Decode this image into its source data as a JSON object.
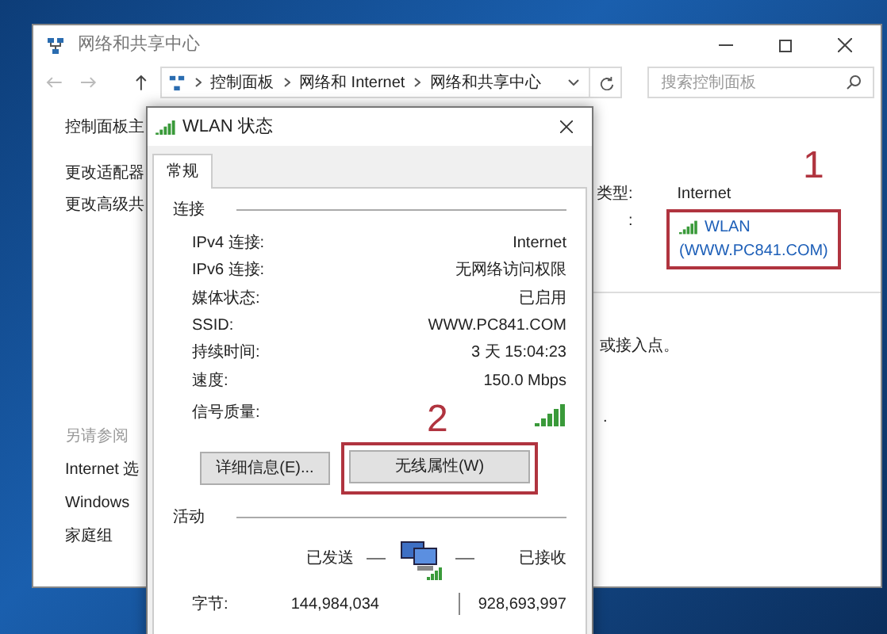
{
  "window": {
    "title": "网络和共享中心",
    "address_path": [
      "控制面板",
      "网络和 Internet",
      "网络和共享中心"
    ],
    "search": {
      "placeholder": "搜索控制面板"
    }
  },
  "sidebar": {
    "links": [
      "控制面板主",
      "更改适配器",
      "更改高级共"
    ],
    "see_also_title": "另请参阅",
    "see_also": [
      "Internet 选",
      "Windows",
      "家庭组"
    ]
  },
  "main": {
    "type_label": "类型:",
    "type_value": "Internet",
    "conn_label": ":",
    "conn_name": "WLAN",
    "conn_ssid": "(WWW.PC841.COM)",
    "text_1": "或接入点。",
    "text_2": "."
  },
  "annotations": [
    {
      "label": "1"
    },
    {
      "label": "2"
    }
  ],
  "dialog": {
    "title": "WLAN 状态",
    "tabs": [
      {
        "label": "常规",
        "selected": true
      }
    ],
    "connection_title": "连接",
    "rows": [
      {
        "label": "IPv4 连接:",
        "value": "Internet"
      },
      {
        "label": "IPv6 连接:",
        "value": "无网络访问权限"
      },
      {
        "label": "媒体状态:",
        "value": "已启用"
      },
      {
        "label": "SSID:",
        "value": "WWW.PC841.COM"
      },
      {
        "label": "持续时间:",
        "value": "3 天 15:04:23"
      },
      {
        "label": "速度:",
        "value": "150.0 Mbps"
      }
    ],
    "signal_label": "信号质量:",
    "buttons": [
      {
        "label": "详细信息(E)...",
        "highlighted": false
      },
      {
        "label": "无线属性(W)",
        "highlighted": true
      }
    ],
    "activity_title": "活动",
    "sent_label": "已发送",
    "received_label": "已接收",
    "bytes_label": "字节:",
    "bytes_sent": "144,984,034",
    "bytes_received": "928,693,997"
  }
}
